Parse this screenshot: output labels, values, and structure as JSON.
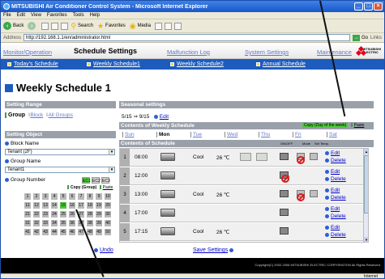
{
  "window": {
    "title": "MITSUBISHI Air Conditioner Control System - Microsoft Internet Explorer"
  },
  "menu": [
    "File",
    "Edit",
    "View",
    "Favorites",
    "Tools",
    "Help"
  ],
  "toolbar": {
    "back": "Back",
    "search": "Search",
    "favorites": "Favorites",
    "media": "Media"
  },
  "address": {
    "label": "Address",
    "url": "http://192.168.1.1/en/administrator.html",
    "go": "Go",
    "links": "Links"
  },
  "nav_main": [
    {
      "label": "Monitor/Operation",
      "active": false
    },
    {
      "label": "Schedule Settings",
      "active": true
    },
    {
      "label": "Malfunction Log",
      "active": false
    },
    {
      "label": "System Settings",
      "active": false
    },
    {
      "label": "Maintenance",
      "active": false
    }
  ],
  "logo": {
    "line1": "MITSUBISHI",
    "line2": "ELECTRIC"
  },
  "nav_sub": [
    "Today's Schedule",
    "Weekly Schedule1",
    "Weekly Schedule2",
    "Annual Schedule"
  ],
  "page_title": "Weekly Schedule 1",
  "setting_range": {
    "header": "Setting Range",
    "group": "Group",
    "block": "Block",
    "all_groups": "All Groups"
  },
  "setting_object": {
    "header": "Setting Object",
    "block_name_label": "Block Name",
    "block_name_value": "Tenant (2F)",
    "group_name_label": "Group Name",
    "group_name_value": "Tenant1",
    "group_number_label": "Group Number",
    "ec_buttons": [
      "EC1",
      "EC2",
      "EC3"
    ],
    "copy": "Copy (Group)",
    "paste": "Paste",
    "group_numbers": [
      "1",
      "2",
      "3",
      "4",
      "5",
      "6",
      "7",
      "8",
      "9",
      "10",
      "11",
      "12",
      "13",
      "14",
      "15",
      "16",
      "17",
      "18",
      "19",
      "20",
      "21",
      "22",
      "23",
      "24",
      "25",
      "26",
      "27",
      "28",
      "29",
      "30",
      "31",
      "32",
      "33",
      "34",
      "35",
      "36",
      "37",
      "38",
      "39",
      "40",
      "41",
      "42",
      "43",
      "44",
      "45",
      "46",
      "47",
      "48",
      "49",
      "50"
    ],
    "selected_group": "15"
  },
  "seasonal": {
    "header": "Seasonal settings",
    "range": "5/15 ⇒ 9/15",
    "edit": "Edit"
  },
  "weekly": {
    "header": "Contents of Weekly Schedule",
    "copy": "Copy (Day of the week)",
    "paste": "Paste",
    "days": [
      {
        "label": "Sun",
        "active": false
      },
      {
        "label": "Mon",
        "active": true
      },
      {
        "label": "Tue",
        "active": false
      },
      {
        "label": "Wed",
        "active": false
      },
      {
        "label": "Thu",
        "active": false
      },
      {
        "label": "Fri",
        "active": false
      },
      {
        "label": "Sat",
        "active": false
      }
    ]
  },
  "schedule": {
    "header": "Contents of Schedule",
    "col_onoff": "ON/OFF",
    "col_mode": "Mode",
    "col_settemp": "Set Temp.",
    "edit": "Edit",
    "delete": "Delete",
    "rows": [
      {
        "num": "1",
        "time": "08:00",
        "mode": "Cool",
        "temp": "26 ℃"
      },
      {
        "num": "2",
        "time": "12:00",
        "mode": "",
        "temp": ""
      },
      {
        "num": "3",
        "time": "13:00",
        "mode": "Cool",
        "temp": "26 ℃"
      },
      {
        "num": "4",
        "time": "17:00",
        "mode": "",
        "temp": ""
      },
      {
        "num": "5",
        "time": "17:15",
        "mode": "Cool",
        "temp": "26 ℃"
      }
    ]
  },
  "footer": {
    "undo": "Undo",
    "save": "Save Settings",
    "copyright": "Copyright(C) 2002-2006 MITSUBISHI ELECTRIC CORPORATION All Rights Reserved."
  },
  "status": {
    "zone": "Internet"
  }
}
